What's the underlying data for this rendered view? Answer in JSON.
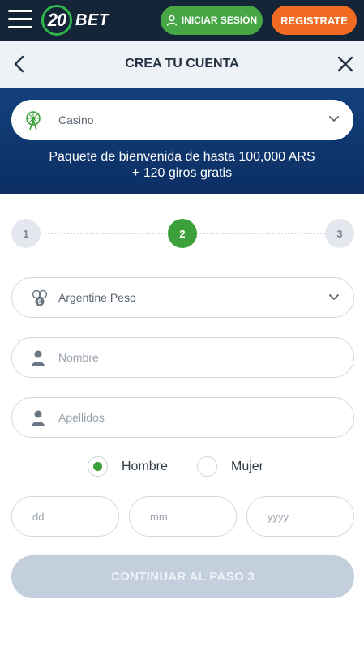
{
  "header": {
    "logo_number": "20",
    "logo_text": "BET",
    "login_label": "INICIAR SESIÓN",
    "register_label": "REGISTRATE"
  },
  "titlebar": {
    "title": "CREA TU CUENTA"
  },
  "banner": {
    "bonus_type": "Casino",
    "promo_line1": "Paquete de bienvenida de hasta 100,000 ARS",
    "promo_line2": "+ 120 giros gratis"
  },
  "steps": [
    {
      "label": "1",
      "state": "inactive"
    },
    {
      "label": "2",
      "state": "active"
    },
    {
      "label": "3",
      "state": "inactive"
    }
  ],
  "form": {
    "currency": "Argentine Peso",
    "first_name_placeholder": "Nombre",
    "last_name_placeholder": "Apellidos",
    "gender_male": "Hombre",
    "gender_female": "Mujer",
    "gender_selected": "Hombre",
    "dob_day_placeholder": "dd",
    "dob_month_placeholder": "mm",
    "dob_year_placeholder": "yyyy",
    "continue_label": "CONTINUAR AL PASO 3"
  },
  "colors": {
    "navbar": "#132537",
    "login_green": "#45a643",
    "register_orange": "#f26b23",
    "banner_blue": "#13407c",
    "active_step_green": "#3da13b",
    "disabled_button": "#c3cfdc"
  }
}
